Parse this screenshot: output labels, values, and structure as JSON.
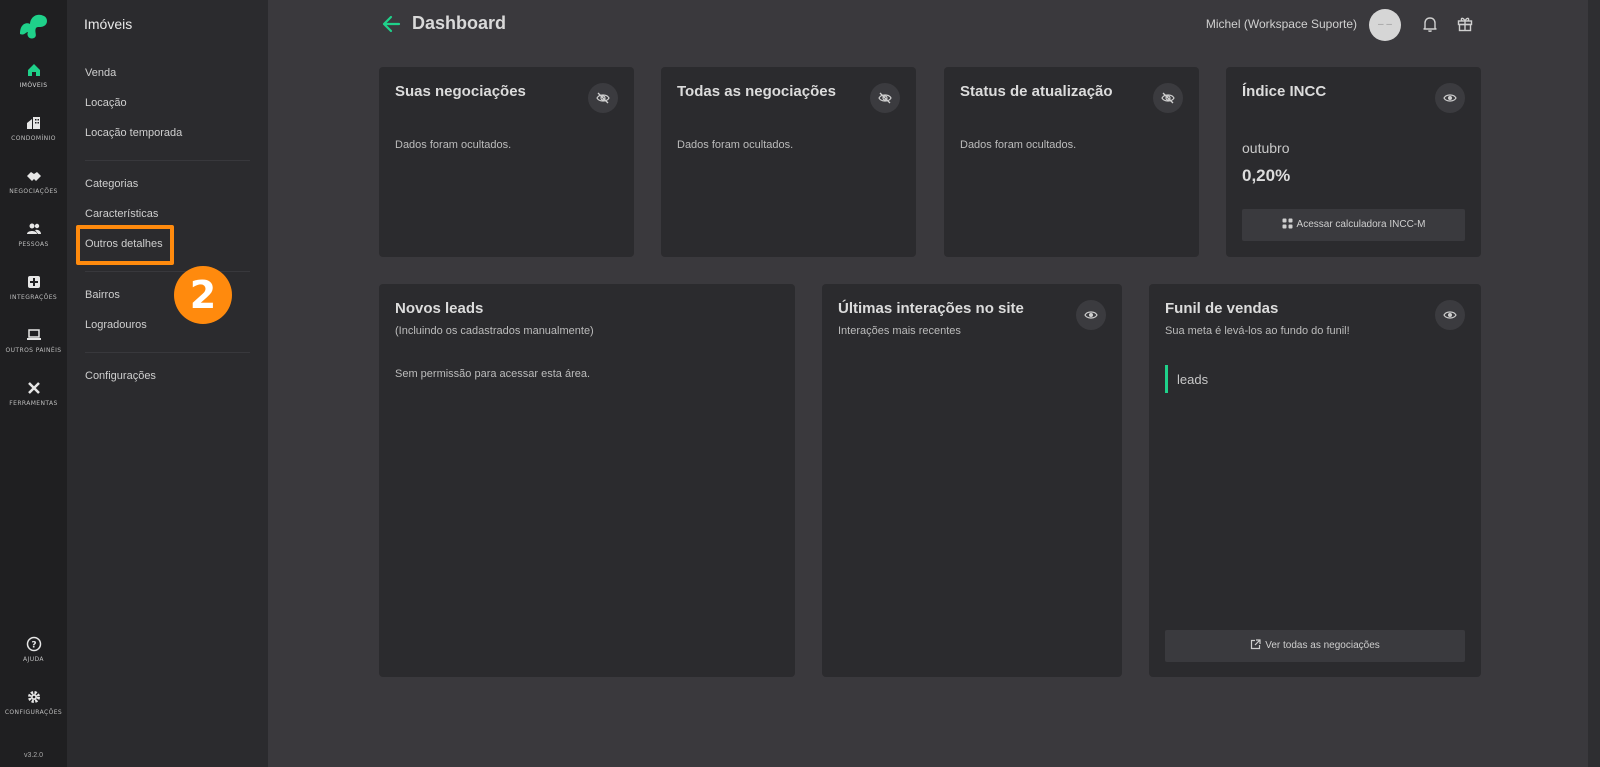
{
  "rail": {
    "items": [
      {
        "label": "IMÓVEIS",
        "icon": "home-icon"
      },
      {
        "label": "CONDOMÍNIO",
        "icon": "building-icon"
      },
      {
        "label": "NEGOCIAÇÕES",
        "icon": "handshake-icon"
      },
      {
        "label": "PESSOAS",
        "icon": "people-icon"
      },
      {
        "label": "INTEGRAÇÕES",
        "icon": "integration-icon"
      },
      {
        "label": "OUTROS PAINÉIS",
        "icon": "laptop-icon"
      },
      {
        "label": "FERRAMENTAS",
        "icon": "tools-icon"
      },
      {
        "label": "AJUDA",
        "icon": "help-icon"
      },
      {
        "label": "CONFIGURAÇÕES",
        "icon": "gear-icon"
      }
    ],
    "version": "v3.2.0",
    "accent": "#1fd18a"
  },
  "submenu": {
    "title": "Imóveis",
    "items": [
      "Venda",
      "Locação",
      "Locação temporada",
      "Categorias",
      "Características",
      "Outros detalhes",
      "Bairros",
      "Logradouros",
      "Configurações"
    ]
  },
  "annotation": {
    "step": "2",
    "color": "#ff8a0d"
  },
  "header": {
    "title": "Dashboard",
    "user": "Michel (Workspace Suporte)",
    "avatar_text": "– –"
  },
  "cards": {
    "suas": {
      "title": "Suas negociações",
      "text": "Dados foram ocultados."
    },
    "todas": {
      "title": "Todas as negociações",
      "text": "Dados foram ocultados."
    },
    "status": {
      "title": "Status de atualização",
      "text": "Dados foram ocultados."
    },
    "incc": {
      "title": "Índice INCC",
      "month": "outubro",
      "value": "0,20%",
      "button": "Acessar calculadora INCC-M"
    },
    "leads": {
      "title": "Novos leads",
      "subtitle": "(Incluindo os cadastrados manualmente)",
      "text": "Sem permissão para acessar esta área."
    },
    "interacoes": {
      "title": "Últimas interações no site",
      "subtitle": "Interações mais recentes"
    },
    "funil": {
      "title": "Funil de vendas",
      "subtitle": "Sua meta é levá-los ao fundo do funil!",
      "stage": "leads",
      "button": "Ver todas as negociações"
    }
  }
}
